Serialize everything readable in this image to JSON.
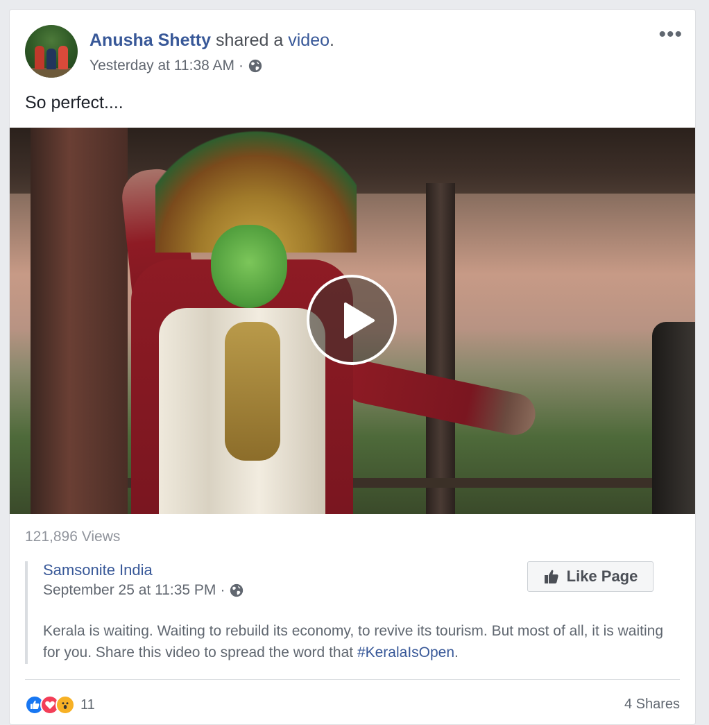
{
  "post": {
    "author": "Anusha Shetty",
    "action": "shared a",
    "object_link": "video",
    "punct": ".",
    "timestamp": "Yesterday at 11:38 AM",
    "dot": "·",
    "message": "So perfect....",
    "more_label": "•••"
  },
  "video": {
    "views": "121,896 Views"
  },
  "shared": {
    "page_name": "Samsonite India",
    "timestamp": "September 25 at 11:35 PM",
    "dot": "·",
    "like_page_label": "Like Page",
    "description": "Kerala is waiting. Waiting to rebuild its economy, to revive its tourism. But most of all, it is waiting for you. Share this video to spread the word that ",
    "hashtag": "#KeralaIsOpen",
    "description_end": "."
  },
  "footer": {
    "reaction_count": "11",
    "shares": "4 Shares"
  },
  "icons": {
    "globe": "globe-icon",
    "play": "play-icon",
    "thumbs_up": "thumbs-up-icon",
    "like_reaction": "like-reaction-icon",
    "love_reaction": "love-reaction-icon",
    "wow_reaction": "wow-reaction-icon",
    "more": "more-options-icon"
  },
  "colors": {
    "link": "#385898",
    "meta": "#616770",
    "card": "#ffffff",
    "background": "#e9ebee"
  }
}
